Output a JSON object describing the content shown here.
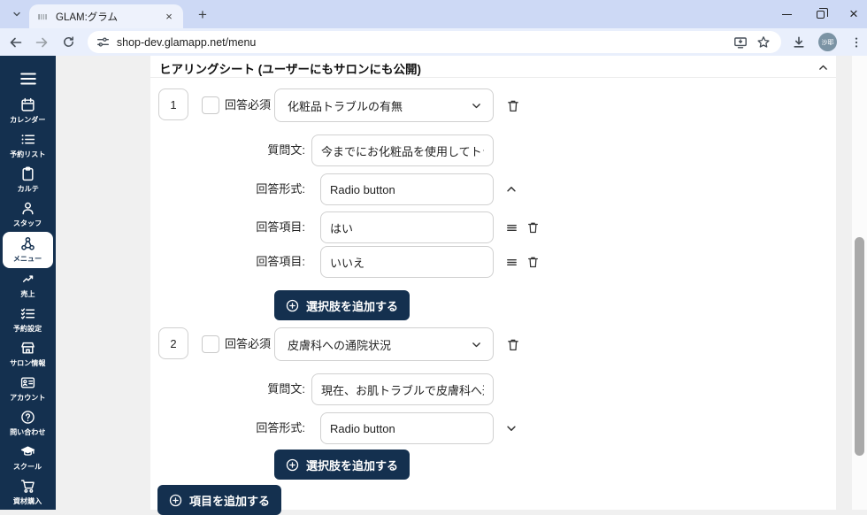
{
  "browser": {
    "tab_title": "GLAM:グラム",
    "new_tab": "+",
    "url": "shop-dev.glamapp.net/menu",
    "avatar": "沙耶"
  },
  "sidebar": {
    "items": [
      {
        "label": "カレンダー"
      },
      {
        "label": "予約リスト"
      },
      {
        "label": "カルテ"
      },
      {
        "label": "スタッフ"
      },
      {
        "label": "メニュー"
      },
      {
        "label": "売上"
      },
      {
        "label": "予約設定"
      },
      {
        "label": "サロン情報"
      },
      {
        "label": "アカウント"
      },
      {
        "label": "問い合わせ"
      },
      {
        "label": "スクール"
      },
      {
        "label": "資材購入"
      }
    ]
  },
  "main": {
    "header_title": "ヒアリングシート (ユーザーにもサロンにも公開)",
    "labels": {
      "required": "回答必須",
      "question_text": "質問文:",
      "answer_format": "回答形式:",
      "answer_option": "回答項目:"
    },
    "buttons": {
      "add_option": "選択肢を追加する",
      "add_item": "項目を追加する"
    },
    "questions": [
      {
        "number": "1",
        "title": "化粧品トラブルの有無",
        "question_text": "今までにお化粧品を使用してトラブルに",
        "answer_format": "Radio button",
        "options": [
          "はい",
          "いいえ"
        ]
      },
      {
        "number": "2",
        "title": "皮膚科への通院状況",
        "question_text": "現在、お肌トラブルで皮膚科へ通ってい",
        "answer_format": "Radio button"
      }
    ]
  }
}
